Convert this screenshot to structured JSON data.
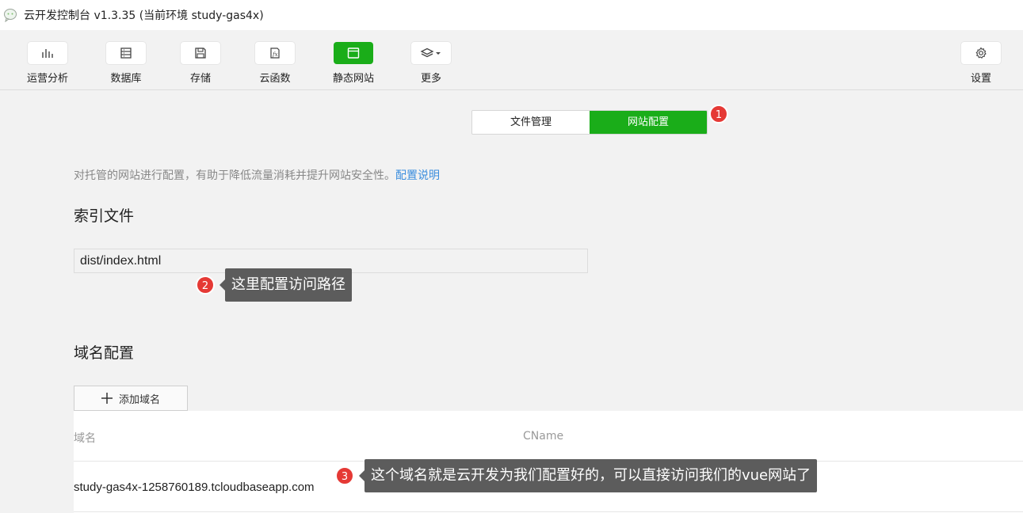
{
  "window": {
    "title": "云开发控制台 v1.3.35 (当前环境 study-gas4x)"
  },
  "toolbar": {
    "items": [
      {
        "label": "运营分析",
        "icon": "bar-chart-icon"
      },
      {
        "label": "数据库",
        "icon": "database-icon"
      },
      {
        "label": "存储",
        "icon": "floppy-disk-icon"
      },
      {
        "label": "云函数",
        "icon": "function-icon"
      },
      {
        "label": "静态网站",
        "icon": "browser-window-icon",
        "active": true
      },
      {
        "label": "更多",
        "icon": "layers-icon"
      }
    ],
    "settings_label": "设置"
  },
  "tabs": {
    "file_manage": "文件管理",
    "site_config": "网站配置",
    "active": "网站配置"
  },
  "steps": {
    "one": "1",
    "two": "2",
    "three": "3"
  },
  "description": {
    "text": "对托管的网站进行配置，有助于降低流量消耗并提升网站安全性。",
    "link": "配置说明"
  },
  "index_section": {
    "title": "索引文件",
    "value": "dist/index.html",
    "tooltip": "这里配置访问路径"
  },
  "domain_section": {
    "title": "域名配置",
    "add_button": "添加域名",
    "columns": [
      "域名",
      "CName"
    ],
    "rows": [
      {
        "domain": "study-gas4x-1258760189.tcloudbaseapp.com",
        "cname": ""
      }
    ],
    "tooltip": "这个域名就是云开发为我们配置好的，可以直接访问我们的vue网站了"
  },
  "colors": {
    "accent": "#1aad19",
    "badge": "#e53935",
    "link": "#3b8ede",
    "tooltip_bg": "#5c5c5c"
  }
}
